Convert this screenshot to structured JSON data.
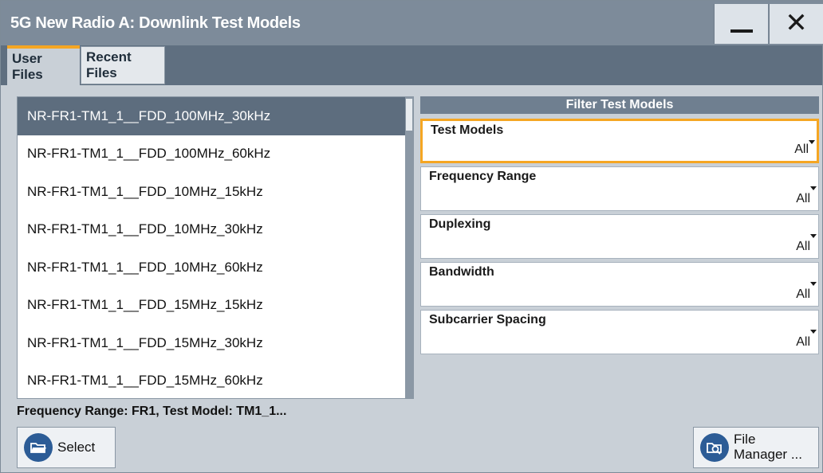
{
  "window": {
    "title": "5G New Radio A: Downlink Test Models"
  },
  "tabs": [
    {
      "label": "User Files",
      "active": true
    },
    {
      "label": "Recent Files",
      "active": false
    }
  ],
  "files": [
    "NR-FR1-TM1_1__FDD_100MHz_30kHz",
    "NR-FR1-TM1_1__FDD_100MHz_60kHz",
    "NR-FR1-TM1_1__FDD_10MHz_15kHz",
    "NR-FR1-TM1_1__FDD_10MHz_30kHz",
    "NR-FR1-TM1_1__FDD_10MHz_60kHz",
    "NR-FR1-TM1_1__FDD_15MHz_15kHz",
    "NR-FR1-TM1_1__FDD_15MHz_30kHz",
    "NR-FR1-TM1_1__FDD_15MHz_60kHz"
  ],
  "selected_index": 0,
  "status": "Frequency Range: FR1, Test Model: TM1_1...",
  "filter": {
    "header": "Filter Test Models",
    "fields": [
      {
        "label": "Test Models",
        "value": "All"
      },
      {
        "label": "Frequency Range",
        "value": "All"
      },
      {
        "label": "Duplexing",
        "value": "All"
      },
      {
        "label": "Bandwidth",
        "value": "All"
      },
      {
        "label": "Subcarrier Spacing",
        "value": "All"
      }
    ]
  },
  "buttons": {
    "select": "Select",
    "file_manager_line1": "File",
    "file_manager_line2": "Manager ..."
  },
  "icons": {
    "minimize": "minimize-icon",
    "close": "close-icon",
    "select": "folder-open-icon",
    "file_manager": "folder-search-icon"
  },
  "colors": {
    "accent": "#f5a623",
    "titlebar": "#7d8b9a",
    "selection": "#5d6d7e",
    "icon_bg": "#2c5c96"
  }
}
